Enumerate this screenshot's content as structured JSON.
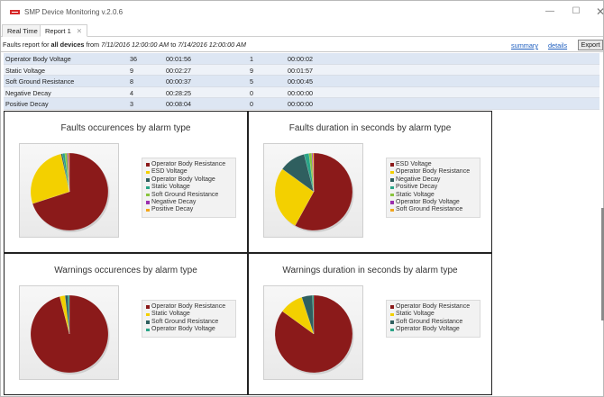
{
  "window": {
    "title": "SMP Device Monitoring v.2.0.6",
    "minimize_glyph": "—",
    "maximize_glyph": "☐",
    "close_glyph": "✕"
  },
  "tabs": [
    {
      "label": "Real Time"
    },
    {
      "label": "Report 1",
      "close_glyph": "✕"
    }
  ],
  "filter": {
    "prefix": "Faults report for ",
    "devices": "all devices",
    "from_word": " from ",
    "from": "7/11/2016 12:00:00 AM",
    "to_word": " to ",
    "to": "7/14/2016 12:00:00 AM"
  },
  "links": {
    "summary": "summary",
    "details": "details"
  },
  "export_label": "Export",
  "table": {
    "rows": [
      [
        "Operator Body Voltage",
        "36",
        "00:01:56",
        "1",
        "00:00:02"
      ],
      [
        "Static Voltage",
        "9",
        "00:02:27",
        "9",
        "00:01:57"
      ],
      [
        "Soft Ground Resistance",
        "8",
        "00:00:37",
        "5",
        "00:00:45"
      ],
      [
        "Negative Decay",
        "4",
        "00:28:25",
        "0",
        "00:00:00"
      ],
      [
        "Positive Decay",
        "3",
        "00:08:04",
        "0",
        "00:00:00"
      ]
    ]
  },
  "chart_data": [
    {
      "type": "pie",
      "title": "Faults occurences by alarm type",
      "labels": [
        "Operator Body Resistance",
        "ESD Voltage",
        "Operator Body Voltage",
        "Static Voltage",
        "Soft Ground Resistance",
        "Negative Decay",
        "Positive Decay"
      ],
      "values": [
        70.0,
        26.5,
        0.6,
        1.0,
        1.0,
        0.5,
        0.4
      ],
      "colors": [
        "#8b1a1a",
        "#f3d000",
        "#2f5f5f",
        "#2aa487",
        "#8ac43f",
        "#9b2fae",
        "#f2a61b"
      ],
      "legend_position": "right"
    },
    {
      "type": "pie",
      "title": "Faults duration in seconds by alarm type",
      "labels": [
        "ESD Voltage",
        "Operator Body Resistance",
        "Negative Decay",
        "Positive Decay",
        "Static Voltage",
        "Operator Body Voltage",
        "Soft Ground Resistance"
      ],
      "values": [
        58.0,
        27.0,
        11.0,
        2.0,
        1.2,
        0.4,
        0.4
      ],
      "colors": [
        "#8b1a1a",
        "#f3d000",
        "#2f5f5f",
        "#2aa487",
        "#8ac43f",
        "#9b2fae",
        "#f2a61b"
      ],
      "legend_position": "right"
    },
    {
      "type": "pie",
      "title": "Warnings occurences by alarm type",
      "labels": [
        "Operator Body Resistance",
        "Static Voltage",
        "Soft Ground Resistance",
        "Operator Body Voltage"
      ],
      "values": [
        96.0,
        2.2,
        1.2,
        0.6
      ],
      "colors": [
        "#8b1a1a",
        "#f3d000",
        "#2f5f5f",
        "#2aa487"
      ],
      "legend_position": "right"
    },
    {
      "type": "pie",
      "title": "Warnings duration in seconds by alarm type",
      "labels": [
        "Operator Body Resistance",
        "Static Voltage",
        "Soft Ground Resistance",
        "Operator Body Voltage"
      ],
      "values": [
        85.0,
        10.0,
        4.5,
        0.5
      ],
      "colors": [
        "#8b1a1a",
        "#f3d000",
        "#2f5f5f",
        "#2aa487"
      ],
      "legend_position": "right"
    }
  ]
}
